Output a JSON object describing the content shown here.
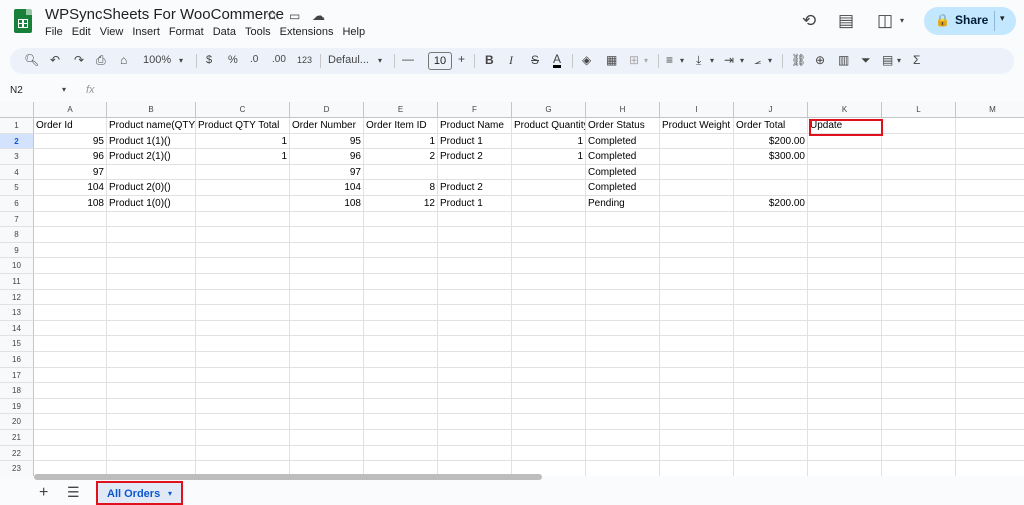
{
  "app": {
    "title": "WPSyncSheets For WooCommerce",
    "menu": [
      "File",
      "Edit",
      "View",
      "Insert",
      "Format",
      "Data",
      "Tools",
      "Extensions",
      "Help"
    ],
    "share_label": "Share",
    "accent": "#c2e7ff"
  },
  "toolbar": {
    "zoom": "100%",
    "currency": "$",
    "percent": "%",
    "dec_decrease": ".0",
    "dec_increase": ".00",
    "number_format": "123",
    "font": "Defaul...",
    "font_size": "10",
    "bold": "B",
    "italic": "I",
    "strike": "S",
    "text_color": "A"
  },
  "formula_bar": {
    "cell_ref": "N2",
    "fx": "fx"
  },
  "sheet": {
    "columns": [
      "A",
      "B",
      "C",
      "D",
      "E",
      "F",
      "G",
      "H",
      "I",
      "J",
      "K",
      "L",
      "M"
    ],
    "row_numbers": [
      "1",
      "2",
      "3",
      "4",
      "5",
      "6",
      "7",
      "8",
      "9",
      "10",
      "11",
      "12",
      "13",
      "14",
      "15",
      "16",
      "17",
      "18",
      "19",
      "20",
      "21",
      "22",
      "23"
    ],
    "header_row": [
      "Order Id",
      "Product name(QTY)",
      "Product QTY Total",
      "Order Number",
      "Order Item ID",
      "Product Name",
      "Product Quantity",
      "Order Status",
      "Product Weight",
      "Order Total",
      "Update",
      "",
      ""
    ],
    "rows": [
      [
        "95",
        "Product 1(1)()",
        "1",
        "95",
        "1",
        "Product 1",
        "1",
        "Completed",
        "",
        "$200.00",
        "",
        "",
        ""
      ],
      [
        "96",
        "Product 2(1)()",
        "1",
        "96",
        "2",
        "Product 2",
        "1",
        "Completed",
        "",
        "$300.00",
        "",
        "",
        ""
      ],
      [
        "97",
        "",
        "",
        "97",
        "",
        "",
        "",
        "Completed",
        "",
        "",
        "",
        "",
        ""
      ],
      [
        "104",
        "Product 2(0)()",
        "",
        "104",
        "8",
        "Product 2",
        "",
        "Completed",
        "",
        "",
        "",
        "",
        ""
      ],
      [
        "108",
        "Product 1(0)()",
        "",
        "108",
        "12",
        "Product 1",
        "",
        "Pending",
        "",
        "$200.00",
        "",
        "",
        ""
      ]
    ]
  },
  "tabs": {
    "active": "All Orders"
  },
  "highlight_color": "#e0111d"
}
